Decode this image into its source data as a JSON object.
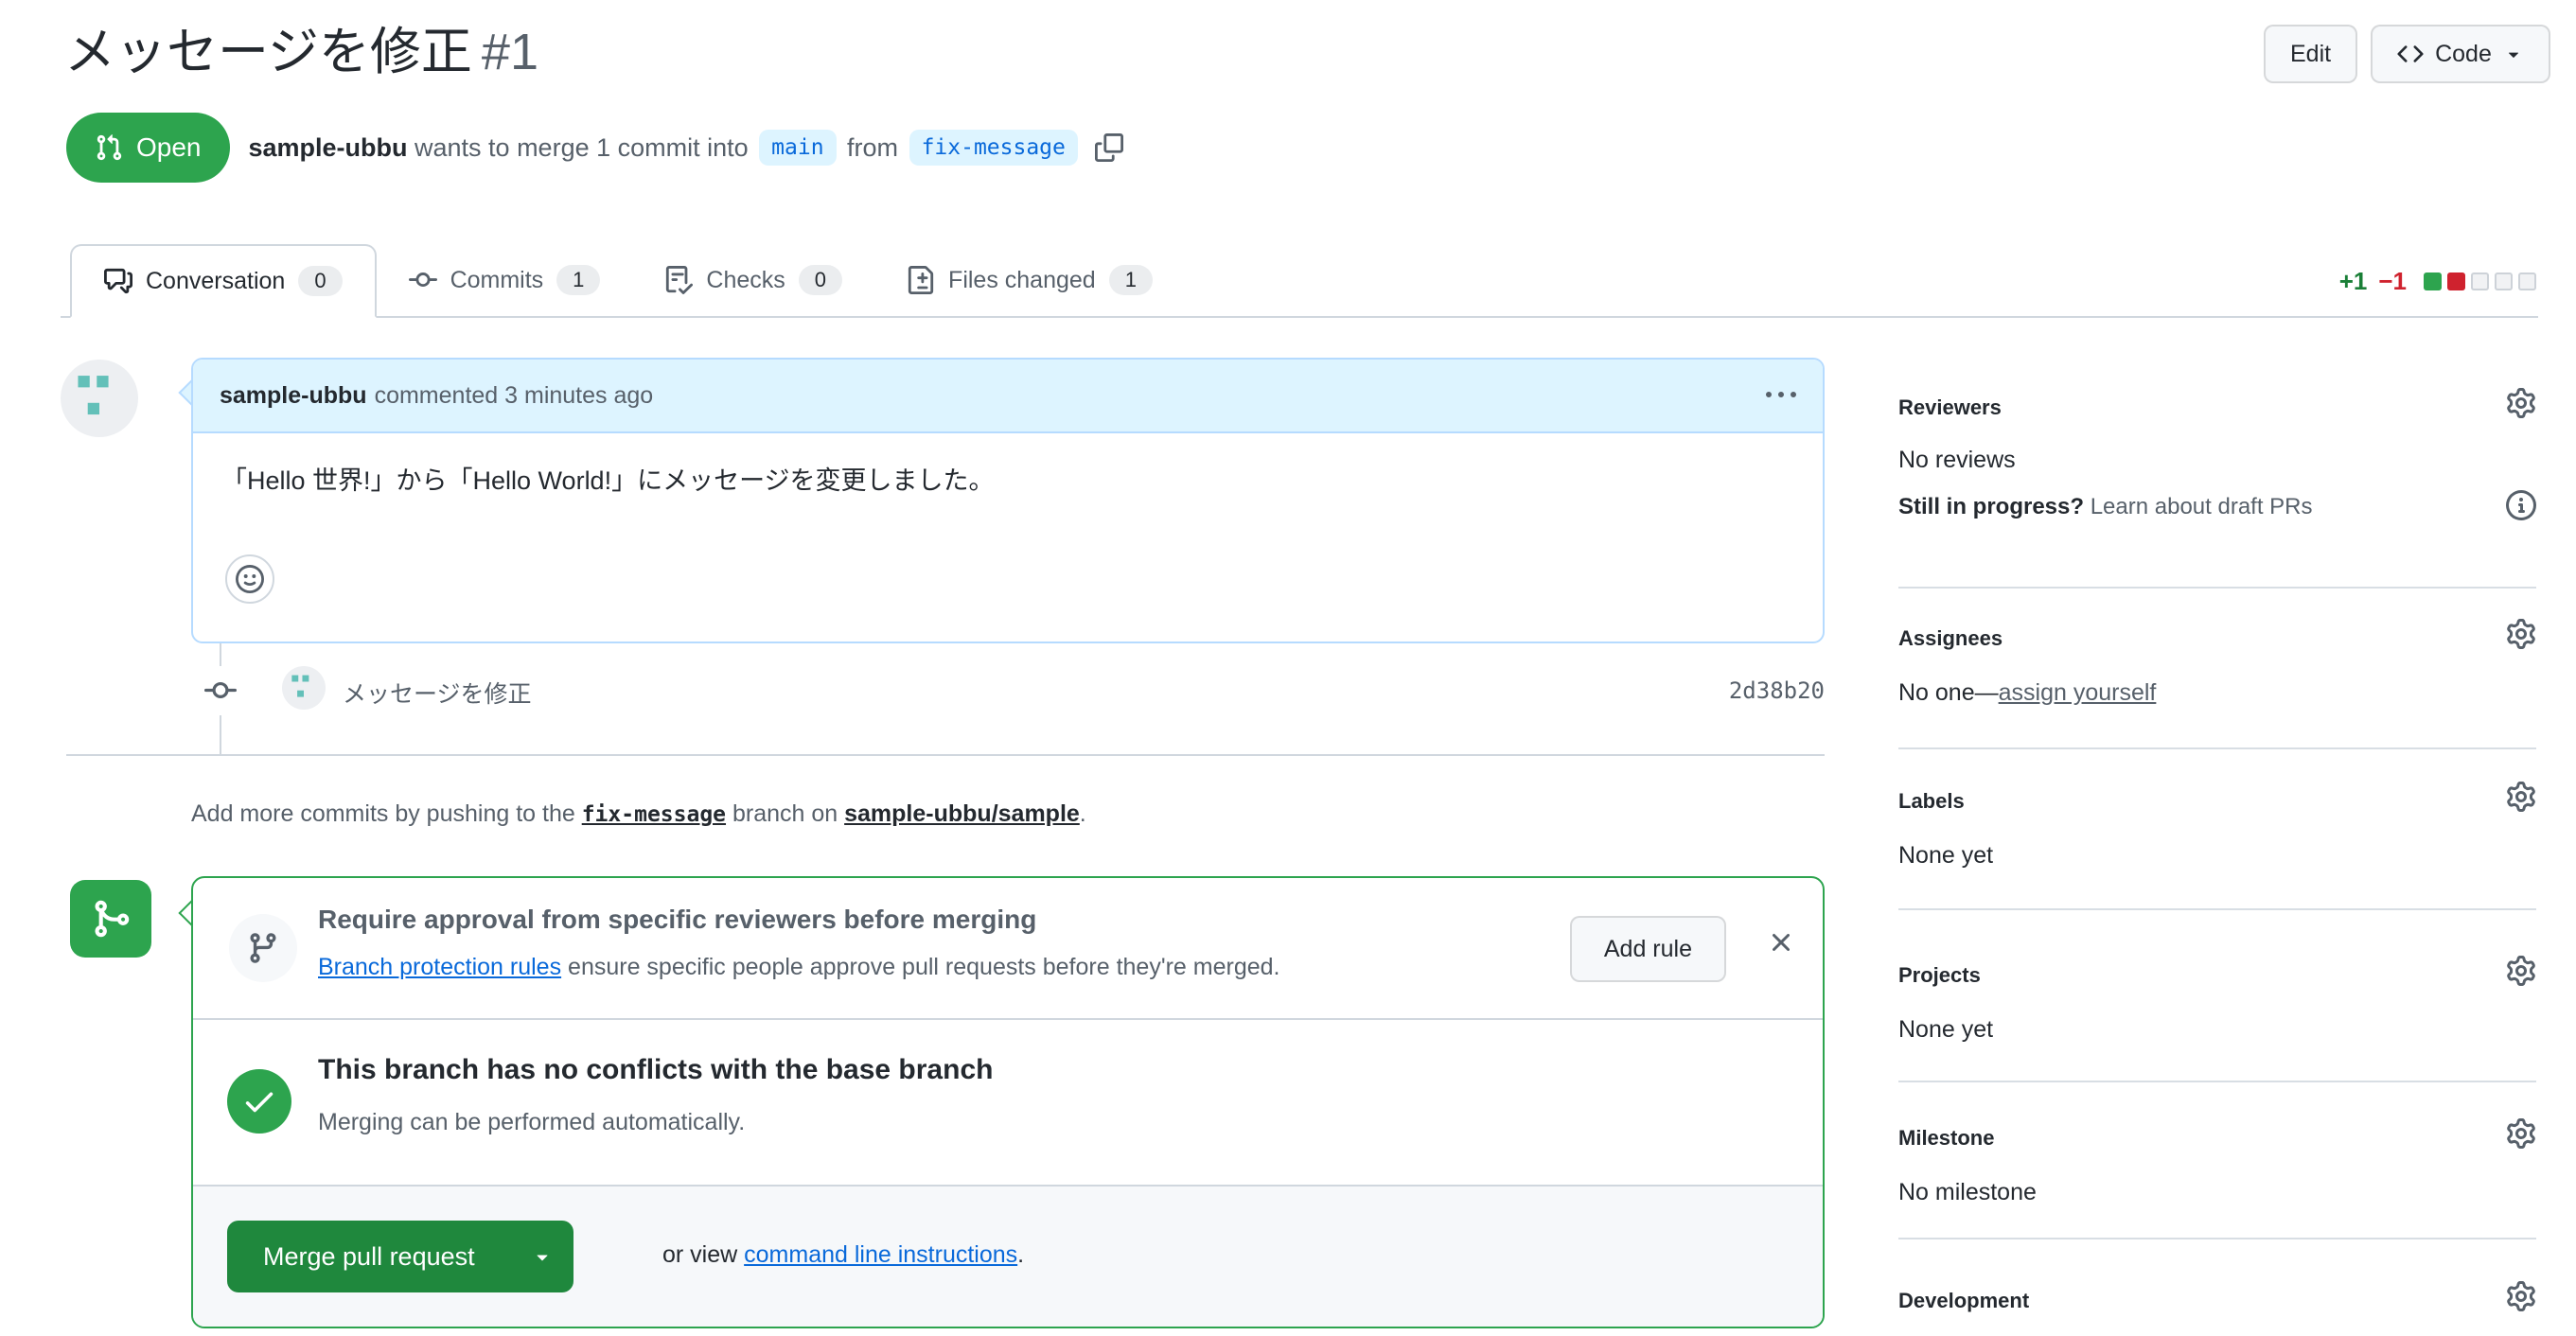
{
  "header": {
    "title": "メッセージを修正",
    "number": "#1",
    "actions": {
      "edit": "Edit",
      "code": "Code"
    },
    "status_badge": "Open",
    "meta": {
      "author": "sample-ubbu",
      "action": " wants to merge 1 commit into ",
      "base_branch": "main",
      "from_word": " from ",
      "head_branch": "fix-message"
    }
  },
  "tabs": [
    {
      "label": "Conversation",
      "count": "0"
    },
    {
      "label": "Commits",
      "count": "1"
    },
    {
      "label": "Checks",
      "count": "0"
    },
    {
      "label": "Files changed",
      "count": "1"
    }
  ],
  "diffstat": {
    "additions": "+1",
    "deletions": "−1"
  },
  "timeline": {
    "comment": {
      "author": "sample-ubbu",
      "meta": "commented 3 minutes ago",
      "body": "「Hello 世界!」から「Hello World!」にメッセージを変更しました。"
    },
    "commit": {
      "message": "メッセージを修正",
      "sha": "2d38b20"
    },
    "push_note": {
      "prefix": "Add more commits by pushing to the ",
      "branch": "fix-message",
      "middle": " branch on ",
      "repo": "sample-ubbu/sample",
      "suffix": "."
    }
  },
  "merge_box": {
    "protection": {
      "title": "Require approval from specific reviewers before merging",
      "link_text": "Branch protection rules",
      "description": " ensure specific people approve pull requests before they're merged.",
      "add_rule": "Add rule"
    },
    "mergeability": {
      "title": "This branch has no conflicts with the base branch",
      "subtitle": "Merging can be performed automatically."
    },
    "actions": {
      "merge": "Merge pull request",
      "or_view": "or view ",
      "cli_link": "command line instructions",
      "suffix": "."
    }
  },
  "sidebar": {
    "reviewers": {
      "title": "Reviewers",
      "empty": "No reviews",
      "draft_q": "Still in progress? ",
      "draft_link": "Learn about draft PRs"
    },
    "assignees": {
      "title": "Assignees",
      "empty": "No one—",
      "self_assign": "assign yourself"
    },
    "labels": {
      "title": "Labels",
      "empty": "None yet"
    },
    "projects": {
      "title": "Projects",
      "empty": "None yet"
    },
    "milestone": {
      "title": "Milestone",
      "empty": "No milestone"
    },
    "development": {
      "title": "Development"
    }
  },
  "colors": {
    "open_badge_green": "#2da44e",
    "merge_button_green": "#1f883d",
    "link_blue": "#0969da",
    "branch_label_bg": "#ddf4ff",
    "comment_header_bg": "#ddf4ff",
    "addition_green": "#1a7f37",
    "deletion_red": "#cf222e",
    "border_gray": "#d0d7de",
    "muted_text": "#57606a",
    "identicon_teal": "#63c0b9"
  }
}
